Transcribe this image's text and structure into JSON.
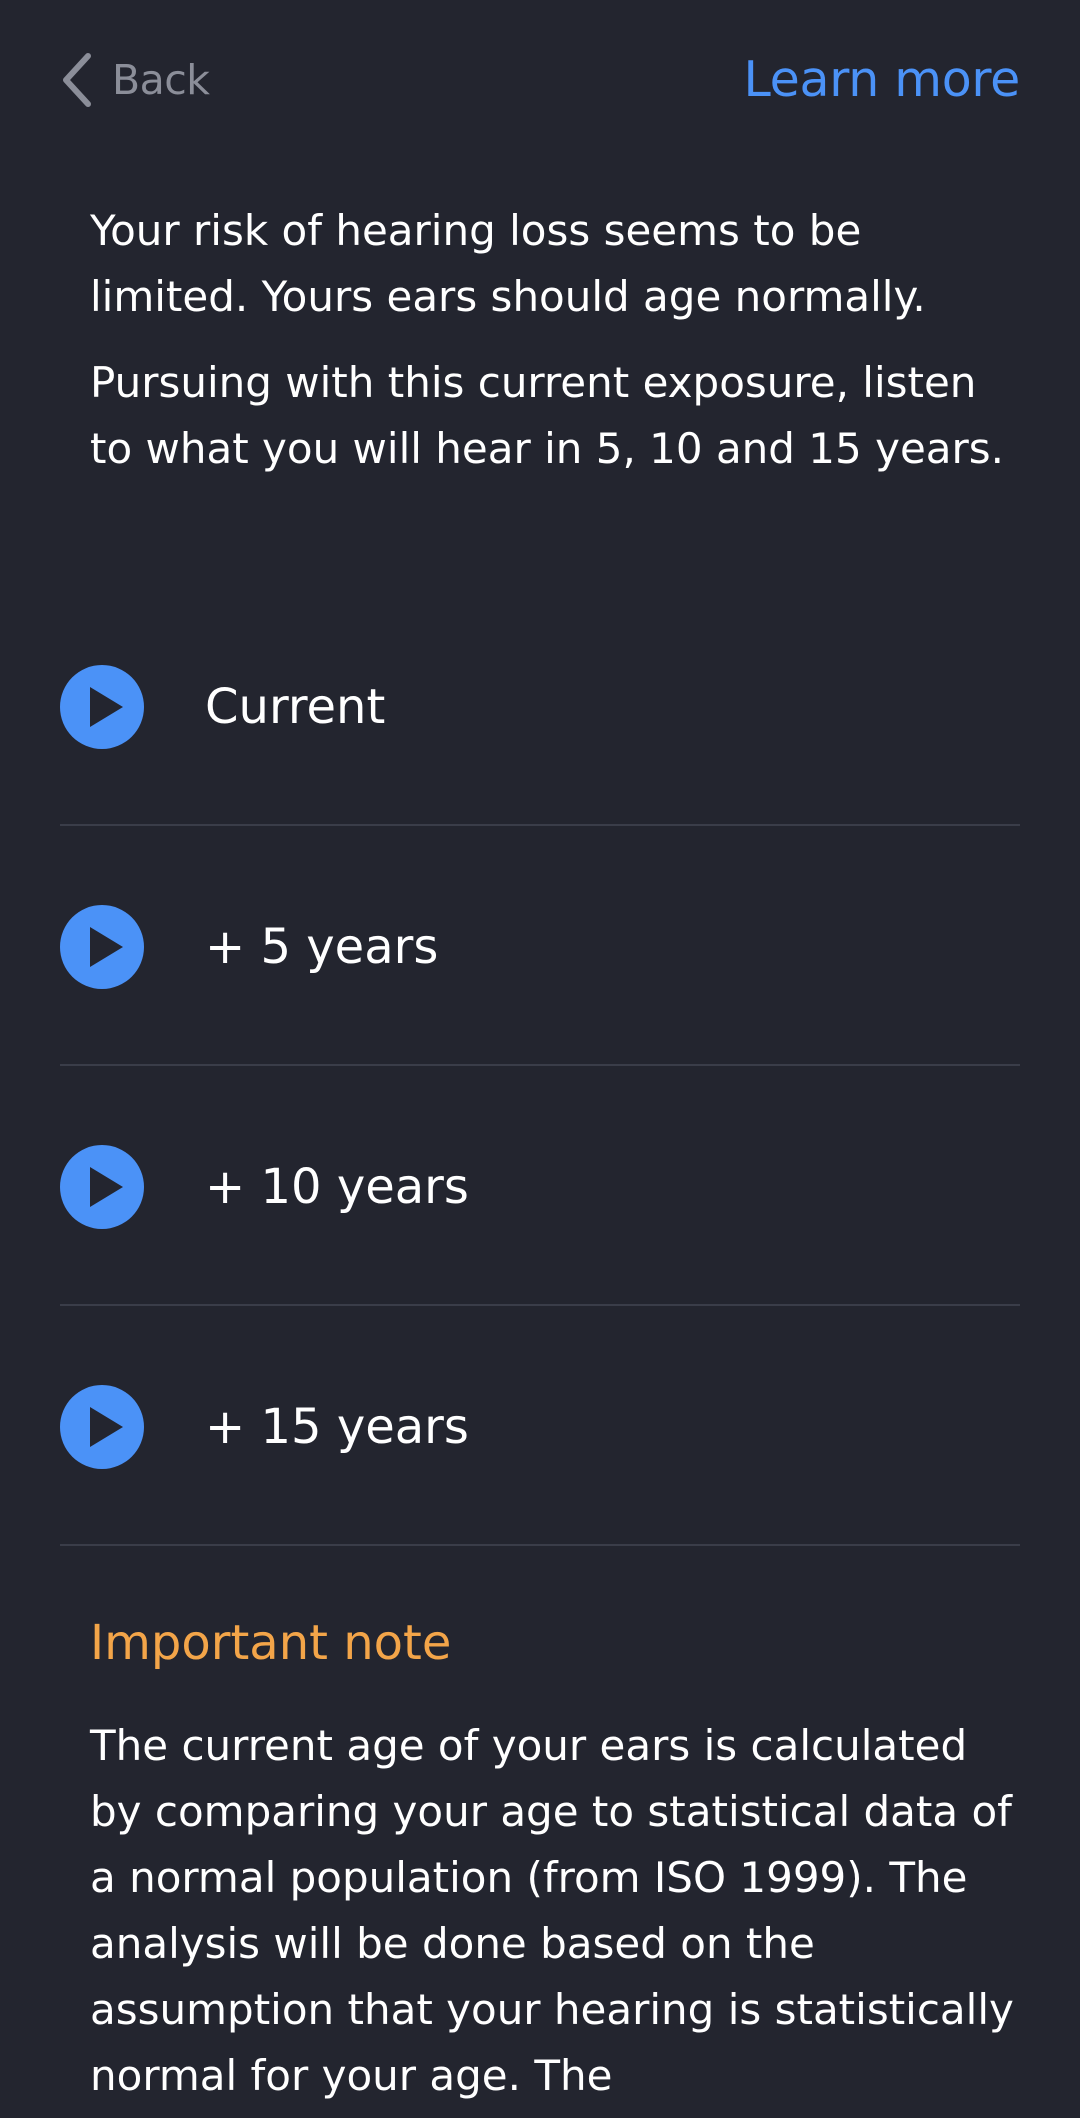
{
  "header": {
    "back_label": "Back",
    "learn_more_label": "Learn more"
  },
  "intro": {
    "paragraph1": "Your risk of hearing loss seems to be limited. Yours ears should age normally.",
    "paragraph2": "Pursuing with this current exposure, listen to what you will hear in 5, 10 and 15 years."
  },
  "playlist": {
    "items": [
      {
        "label": "Current",
        "icon": "play-icon"
      },
      {
        "label": "+ 5 years",
        "icon": "play-icon"
      },
      {
        "label": "+ 10 years",
        "icon": "play-icon"
      },
      {
        "label": "+ 15 years",
        "icon": "play-icon"
      }
    ]
  },
  "note": {
    "title": "Important note",
    "body": "The current age of your ears is calculated by comparing your age to statistical data of a normal population (from ISO 1999). The analysis will be done based on the assumption that your hearing is statistically normal for your age. The"
  },
  "colors": {
    "background": "#23252f",
    "accent": "#4b92f7",
    "note_title": "#f3a549",
    "divider": "#3a3d49",
    "back_text": "#8b8e99"
  }
}
